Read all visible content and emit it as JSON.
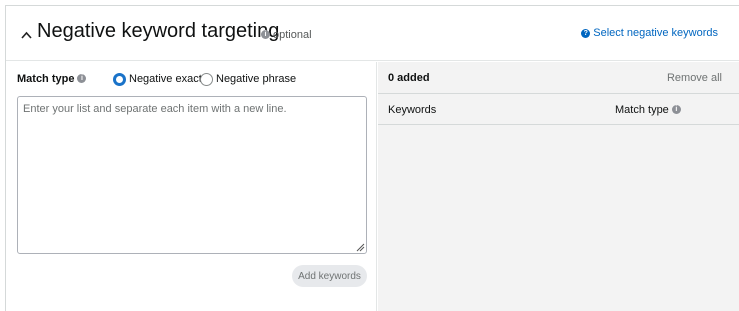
{
  "header": {
    "title": "Negative keyword targeting",
    "optional_label": "optional",
    "select_link": "Select negative keywords",
    "chevron_icon": "chevron-up-icon"
  },
  "match_type": {
    "label": "Match type",
    "options": [
      {
        "label": "Negative exact",
        "checked": true
      },
      {
        "label": "Negative phrase",
        "checked": false
      }
    ]
  },
  "input": {
    "value": "",
    "placeholder": "Enter your list and separate each item with a new line."
  },
  "actions": {
    "add_keywords": "Add keywords"
  },
  "added_panel": {
    "count_label": "0 added",
    "remove_all": "Remove all",
    "columns": [
      "Keywords",
      "Match type"
    ]
  },
  "colors": {
    "link": "#0066c0",
    "radio_accent": "#1a73c9",
    "panel_bg": "#f3f3f3",
    "button_bg": "#e7e9ec"
  }
}
